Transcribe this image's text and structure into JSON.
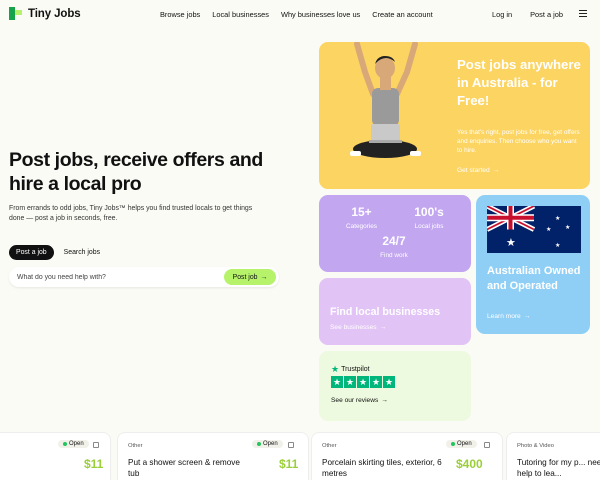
{
  "brand": {
    "name": "Tiny Jobs"
  },
  "nav": {
    "links": [
      "Browse jobs",
      "Local businesses",
      "Why businesses love us",
      "Create an account"
    ],
    "login": "Log in",
    "post": "Post a job"
  },
  "hero": {
    "title": "Post jobs, receive offers and hire a local pro",
    "subtitle": "From errands to odd jobs, Tiny Jobs™ helps you find trusted locals to get things done — post a job in seconds, free.",
    "tabs": [
      "Post a job",
      "Search jobs"
    ],
    "search_placeholder": "What do you need help with?",
    "post_button": "Post job"
  },
  "cards": {
    "yellow": {
      "title": "Post jobs anywhere in Australia - for Free!",
      "body": "Yes that's right, post jobs for free, get offers and enquiries. Then choose who you want to hire.",
      "link": "Get started"
    },
    "stats": [
      {
        "value": "15+",
        "label": "Categories"
      },
      {
        "value": "100's",
        "label": "Local jobs"
      },
      {
        "value": "24/7",
        "label": "Find work"
      }
    ],
    "blue": {
      "title": "Australian Owned and Operated",
      "link": "Learn more"
    },
    "lilac": {
      "title": "Find local businesses",
      "link": "See businesses"
    },
    "trustpilot": {
      "brand": "Trustpilot",
      "link": "See our reviews"
    }
  },
  "listings": [
    {
      "status": "Open",
      "price": "$11",
      "category": "",
      "title": ""
    },
    {
      "status": "Open",
      "price": "$11",
      "category": "Other",
      "title": "Put a shower screen & remove tub"
    },
    {
      "status": "Open",
      "price": "$400",
      "category": "Other",
      "title": "Porcelain skirting tiles, exterior, 6 metres"
    },
    {
      "status": "",
      "price": "",
      "category": "Photo & Video",
      "title": "Tutoring for my p... need help to lea..."
    }
  ],
  "colors": {
    "accent_green": "#b6f36b",
    "yellow_card": "#fcd462",
    "purple_card": "#c2a6f0",
    "blue_card": "#8fcff6",
    "lilac_card": "#e2c3f5",
    "trustpilot_green": "#00b67a",
    "price_green": "#9bcf3a"
  },
  "icons": [
    "arrow-right-icon",
    "trustpilot-star-icon",
    "bookmark-icon",
    "menu-icon",
    "australian-flag-icon"
  ]
}
